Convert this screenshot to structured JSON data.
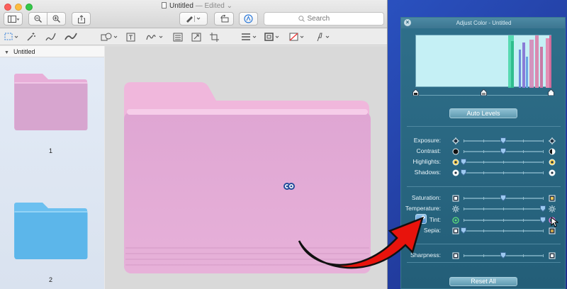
{
  "window": {
    "title": "Untitled",
    "status": "— Edited",
    "status_chevron": "⌄",
    "search_placeholder": "Search"
  },
  "sidebar": {
    "document_name": "Untitled",
    "pages": [
      {
        "number": "1",
        "color": "#e4a6d0"
      },
      {
        "number": "2",
        "color": "#5cb6ea"
      }
    ]
  },
  "canvas": {
    "folder_color": "#e8aad4"
  },
  "panel": {
    "title": "Adjust Color - Untitled",
    "auto_levels_label": "Auto Levels",
    "reset_all_label": "Reset All",
    "sliders": [
      {
        "label": "Exposure:",
        "icon_left": "exposure-low-icon",
        "icon_right": "exposure-high-icon",
        "value": 0.5
      },
      {
        "label": "Contrast:",
        "icon_left": "contrast-low-icon",
        "icon_right": "contrast-high-icon",
        "value": 0.5
      },
      {
        "label": "Highlights:",
        "icon_left": "highlights-low-icon",
        "icon_right": "highlights-high-icon",
        "value": 0.0
      },
      {
        "label": "Shadows:",
        "icon_left": "shadows-low-icon",
        "icon_right": "shadows-high-icon",
        "value": 0.0
      },
      {
        "label": "Saturation:",
        "icon_left": "saturation-low-icon",
        "icon_right": "saturation-high-icon",
        "value": 0.5
      },
      {
        "label": "Temperature:",
        "icon_left": "temperature-cool-icon",
        "icon_right": "temperature-warm-icon",
        "value": 1.0
      },
      {
        "label": "Tint:",
        "icon_left": "tint-green-icon",
        "icon_right": "tint-magenta-icon",
        "value": 1.0
      },
      {
        "label": "Sepia:",
        "icon_left": "sepia-low-icon",
        "icon_right": "sepia-high-icon",
        "value": 0.0
      },
      {
        "label": "Sharpness:",
        "icon_left": "sharpness-low-icon",
        "icon_right": "sharpness-high-icon",
        "value": 0.5
      }
    ]
  },
  "colors": {
    "arrow": "#e8130c",
    "panel_bg": "#235e78",
    "histogram_bg": "#c5f0f5"
  }
}
